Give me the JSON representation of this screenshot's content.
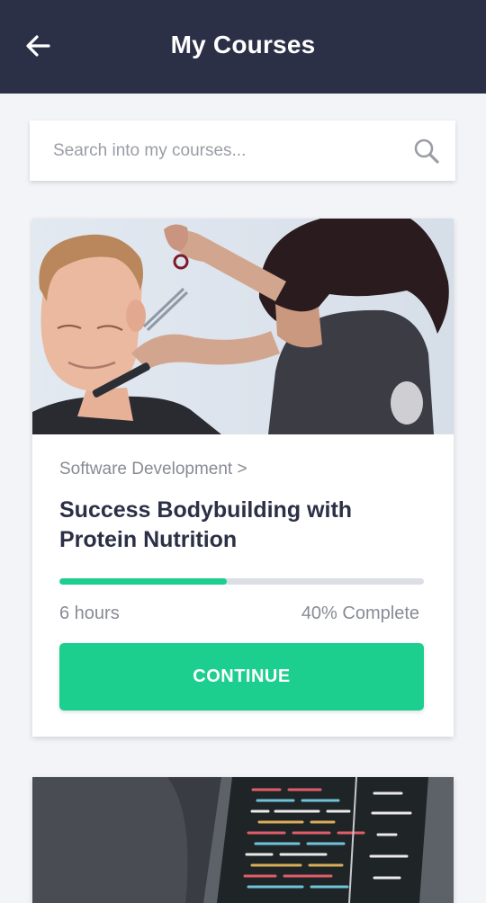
{
  "header": {
    "title": "My Courses",
    "back_icon": "arrow-left-icon",
    "background": "#2b3046"
  },
  "search": {
    "placeholder": "Search into my courses...",
    "value": "",
    "icon": "search-icon"
  },
  "courses": [
    {
      "image": "barber-cutting-hair-photo",
      "category": "Software Development >",
      "title": "Success Bodybuilding with Protein Nutrition",
      "progress": 0.46,
      "duration": "6 hours",
      "completion": "40% Complete",
      "button_label": "CONTINUE"
    },
    {
      "image": "laptop-code-photo"
    }
  ],
  "colors": {
    "accent": "#1ccf8f",
    "track": "#dcdee5",
    "muted_text": "#888b94",
    "title_text": "#2b3046",
    "page_background": "#f3f4f8"
  }
}
